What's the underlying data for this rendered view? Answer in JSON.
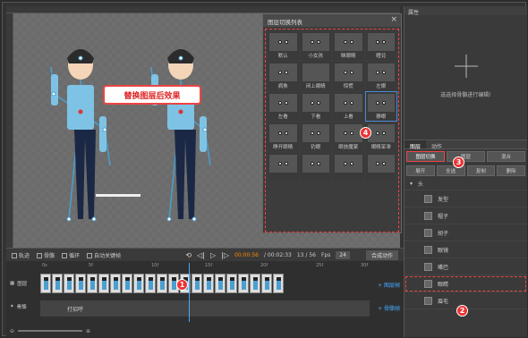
{
  "callout_label": "替换图层后效果",
  "popup": {
    "title": "图层切换列表",
    "items": [
      "默认",
      "小女孩",
      "眯眼睛",
      "瞪兑",
      "病魚",
      "闭上眼睛",
      "惊慌",
      "左眼",
      "左看",
      "下看",
      "上看",
      "静眼",
      "睁开眼睛",
      "钓眼",
      "眼放魔紧",
      "眼睛呆滞",
      "",
      "",
      "",
      ""
    ]
  },
  "right": {
    "panel_title": "属性",
    "prop_message": "选选择骨骼进行编辑!",
    "tabs": [
      "图层",
      "动作"
    ],
    "btnrow1": [
      "图层切换",
      "图层",
      "混合"
    ],
    "btnrow2": [
      "展开",
      "全选",
      "复制",
      "删除"
    ],
    "tree_root": "头",
    "tree_items": [
      "发型",
      "帽子",
      "胡子",
      "眼镜",
      "嘴巴",
      "眼睛",
      "眉毛"
    ]
  },
  "timeline": {
    "check_labels": [
      "轨迹",
      "骨骼",
      "循环",
      "自动关键帧"
    ],
    "time_current": "00:00:56",
    "time_total": "/ 00:02:33",
    "frame_count": "13 / 56",
    "fps_label": "Fps",
    "fps_value": "24",
    "compose_button": "合成动作",
    "ticks": [
      "0s",
      "5f",
      "10f",
      "15f",
      "20f",
      "25f",
      "30f"
    ],
    "track_image": "图层",
    "track_bone": "骨骼",
    "bone_bar_text": "打招呼",
    "add_image_frame": "+ 图层帧",
    "add_bone_frame": "+ 骨骼帧"
  },
  "badges": [
    "1",
    "2",
    "3",
    "4"
  ],
  "colors": {
    "accent_red": "#e33333",
    "accent_blue": "#44aaff"
  }
}
